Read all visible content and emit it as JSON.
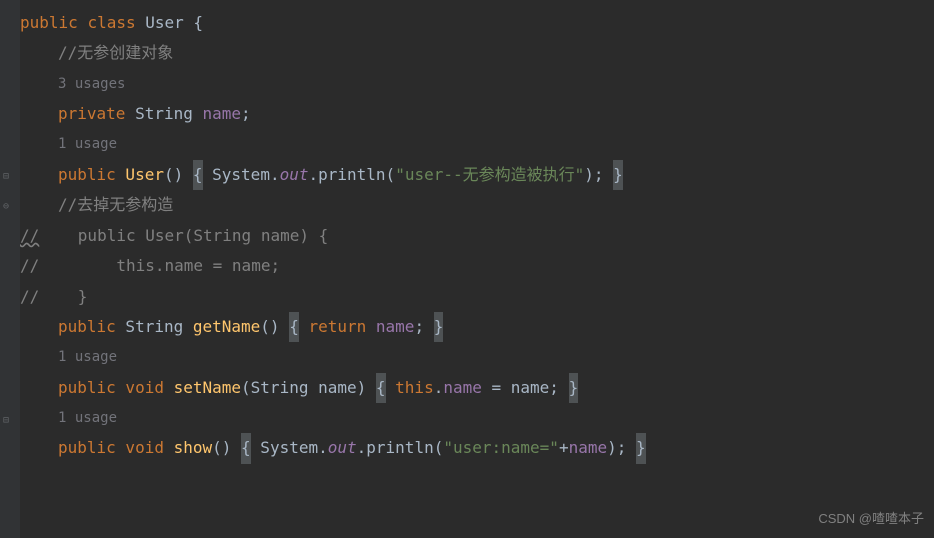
{
  "code": {
    "l1": {
      "kw1": "public",
      "kw2": "class",
      "name": "User",
      "brace": " {"
    },
    "l2": {
      "comment": "//无参创建对象"
    },
    "l3": {
      "usage": "3 usages"
    },
    "l4": {
      "kw": "private",
      "type": " String ",
      "field": "name",
      "semi": ";"
    },
    "l5": {
      "usage": "1 usage"
    },
    "l6": {
      "kw": "public",
      "ctor": " User",
      "parens": "() ",
      "lbrace": "{",
      "sys": " System.",
      "out": "out",
      "print": ".println(",
      "str": "\"user--无参构造被执行\"",
      "close": "); ",
      "rbrace": "}"
    },
    "l7": {
      "comment": "//去掉无参构造"
    },
    "l8": {
      "cm": "//",
      "text": "    public User(String name) {"
    },
    "l9": {
      "cm": "//",
      "text": "        this.name = name;"
    },
    "l10": {
      "cm": "//",
      "text": "    }"
    },
    "l11": {
      "kw": "public",
      "type": " String ",
      "method": "getName",
      "parens": "() ",
      "lbrace": "{",
      "ret": " return ",
      "field": "name",
      "close": "; ",
      "rbrace": "}"
    },
    "l12": {
      "usage": "1 usage"
    },
    "l13": {
      "kw": "public",
      "void": " void ",
      "method": "setName",
      "sig": "(String name) ",
      "lbrace": "{",
      "this": " this",
      "dot": ".",
      "field": "name",
      "eq": " = name; ",
      "rbrace": "}"
    },
    "l14": {
      "usage": "1 usage"
    },
    "l15": {
      "kw": "public",
      "void": " void ",
      "method": "show",
      "parens": "() ",
      "lbrace": "{",
      "sys": " System.",
      "out": "out",
      "print": ".println(",
      "str": "\"user:name=\"",
      "plus": "+",
      "field": "name",
      "close": "); ",
      "rbrace": "}"
    }
  },
  "watermark": "CSDN @喳喳本子"
}
